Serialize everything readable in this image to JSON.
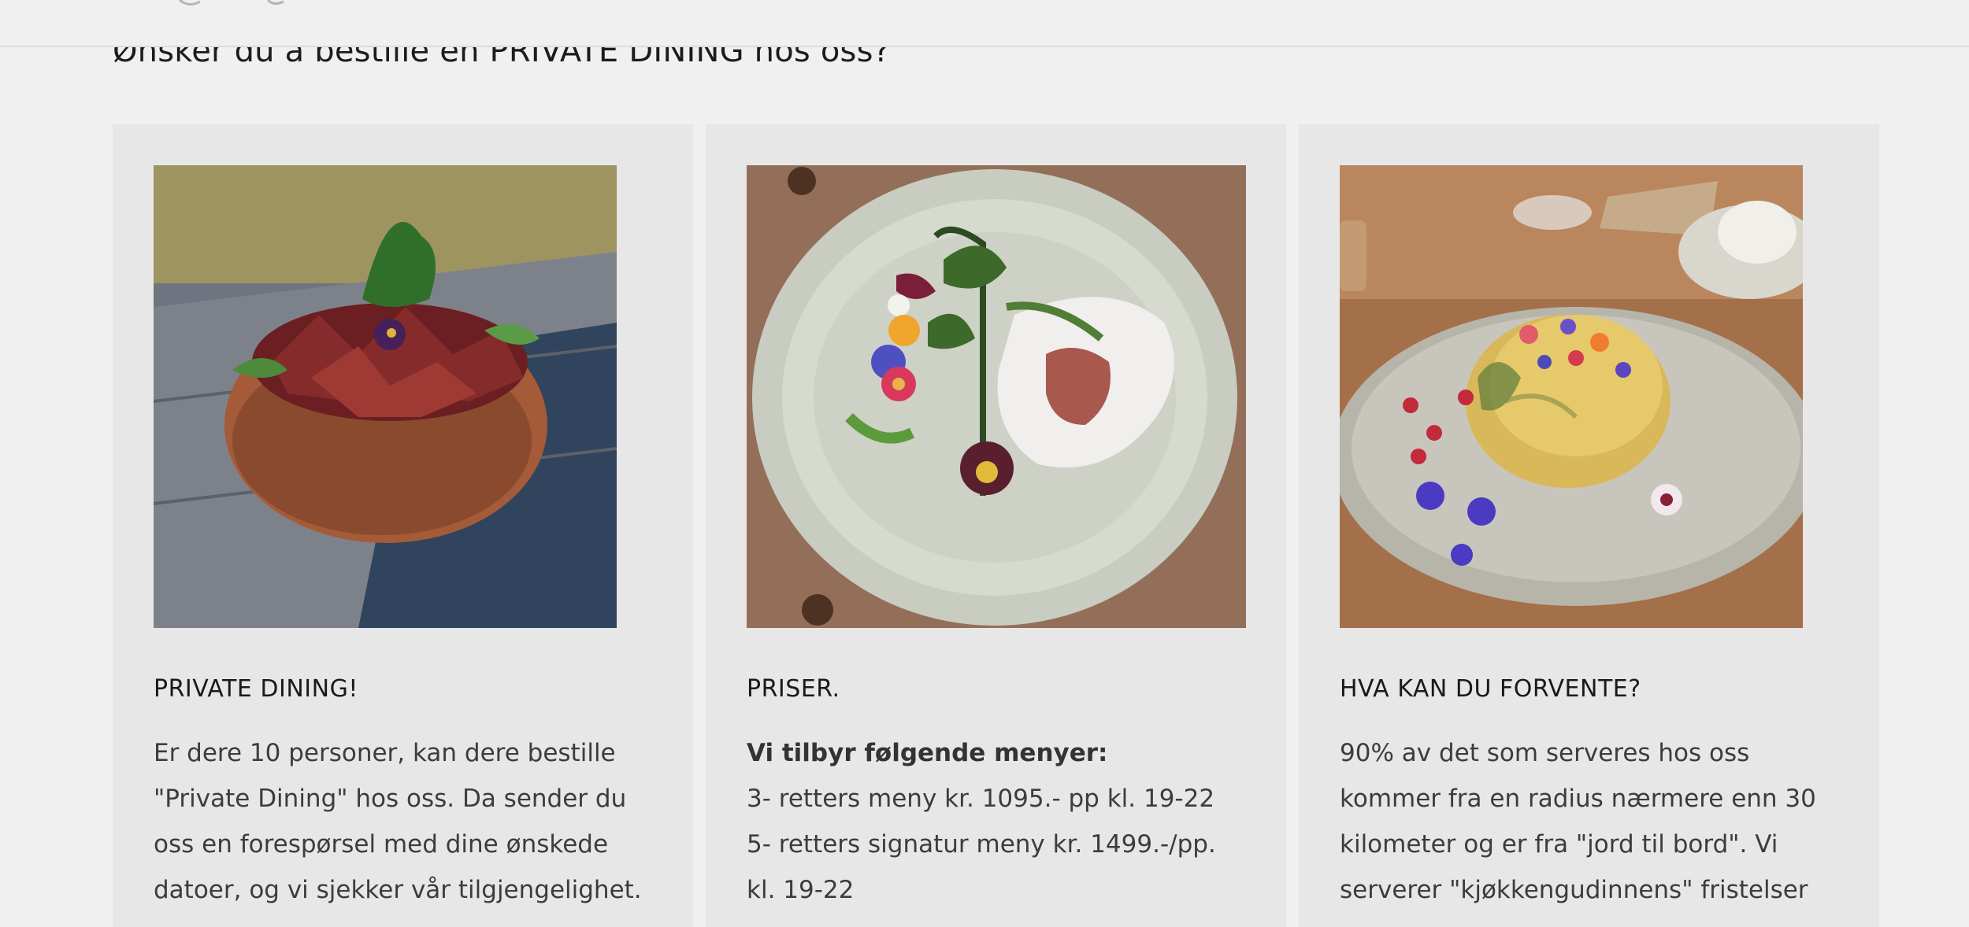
{
  "page": {
    "title": "Ønsker du å bestille en PRIVATE DINING hos oss?"
  },
  "cards": [
    {
      "heading": "PRIVATE DINING!",
      "image_icon": "dried-meat-bowl-photo",
      "lines": [
        "Er dere 10 personer, kan dere bestille",
        "\"Private Dining\" hos oss. Da sender du",
        "oss en forespørsel med dine ønskede",
        "datoer, og vi sjekker vår tilgjengelighet."
      ]
    },
    {
      "heading": "PRISER.",
      "image_icon": "plated-dish-with-flowers-photo",
      "intro": "Vi tilbyr følgende menyer:",
      "lines": [
        "3- retters meny kr. 1095.- pp kl. 19-22",
        "5- retters signatur meny kr. 1499.-/pp.",
        "kl. 19-22"
      ]
    },
    {
      "heading": "HVA KAN DU FORVENTE?",
      "image_icon": "butter-with-edible-flowers-photo",
      "lines": [
        "90% av det som serveres hos oss",
        "kommer fra en radius nærmere enn 30",
        "kilometer og er fra \"jord til bord\". Vi",
        "serverer \"kjøkkengudinnens\" fristelser"
      ]
    }
  ],
  "colors": {
    "page_background": "#f0f0f0",
    "card_background": "#e7e7e7",
    "heading_text": "#1a1a1a",
    "body_text": "#3c3c3c"
  }
}
